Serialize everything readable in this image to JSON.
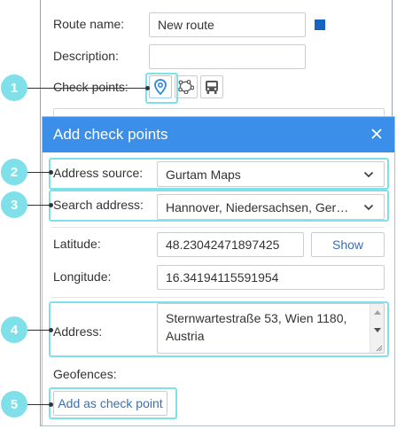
{
  "route": {
    "name_label": "Route name:",
    "name_value": "New route",
    "color": "#1565c0",
    "description_label": "Description:",
    "description_value": "",
    "checkpoints_label": "Check points:",
    "checkpoint_buttons": [
      "map-pin-icon",
      "polygon-icon",
      "bus-icon"
    ]
  },
  "dialog": {
    "title": "Add check points",
    "close_icon": "close-icon",
    "address_source_label": "Address source:",
    "address_source_value": "Gurtam Maps",
    "search_address_label": "Search address:",
    "search_address_value": "Hannover, Niedersachsen, Germany",
    "latitude_label": "Latitude:",
    "latitude_value": "48.23042471897425",
    "show_button": "Show",
    "longitude_label": "Longitude:",
    "longitude_value": "16.34194115591954",
    "address_label": "Address:",
    "address_value": "Sternwartestraße 53, Wien 1180, Austria",
    "geofences_label": "Geofences:",
    "add_button": "Add as check point"
  },
  "callouts": [
    "1",
    "2",
    "3",
    "4",
    "5"
  ],
  "colors": {
    "header": "#3b8fe8",
    "highlight": "#7fe0ea",
    "link": "#3a6fb0"
  }
}
